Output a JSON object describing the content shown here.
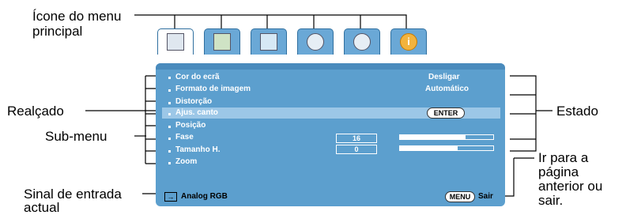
{
  "callouts": {
    "main_menu_icon_line1": "Ícone do menu",
    "main_menu_icon_line2": "principal",
    "highlighted": "Realçado",
    "submenu": "Sub-menu",
    "input_signal_line1": "Sinal de entrada",
    "input_signal_line2": "actual",
    "status": "Estado",
    "goto_line1": "Ir para a",
    "goto_line2": "página",
    "goto_line3": "anterior ou",
    "goto_line4": "sair."
  },
  "tabs": [
    {
      "icon": "picture-adjust-icon"
    },
    {
      "icon": "image-icon"
    },
    {
      "icon": "source-icon"
    },
    {
      "icon": "settings-icon"
    },
    {
      "icon": "advanced-settings-icon"
    },
    {
      "icon": "info-icon"
    }
  ],
  "menu": {
    "items": [
      {
        "label": "Cor do ecrã",
        "value": "Desligar"
      },
      {
        "label": "Formato de imagem",
        "value": "Automático"
      },
      {
        "label": "Distorção",
        "value": ""
      },
      {
        "label": "Ajus. canto",
        "value": "ENTER"
      },
      {
        "label": "Posição",
        "value": ""
      },
      {
        "label": "Fase",
        "value": "16",
        "level": 0.7
      },
      {
        "label": "Tamanho H.",
        "value": "0",
        "level": 0.62
      },
      {
        "label": "Zoom",
        "value": ""
      }
    ],
    "highlighted_index": 3
  },
  "statusbar": {
    "source_icon": "input-source-icon",
    "source": "Analog RGB",
    "menu_key": "MENU",
    "exit": "Sair"
  },
  "colors": {
    "panel": "#5c9fce",
    "highlight": "#9cc7e7",
    "text": "#ffffff"
  }
}
